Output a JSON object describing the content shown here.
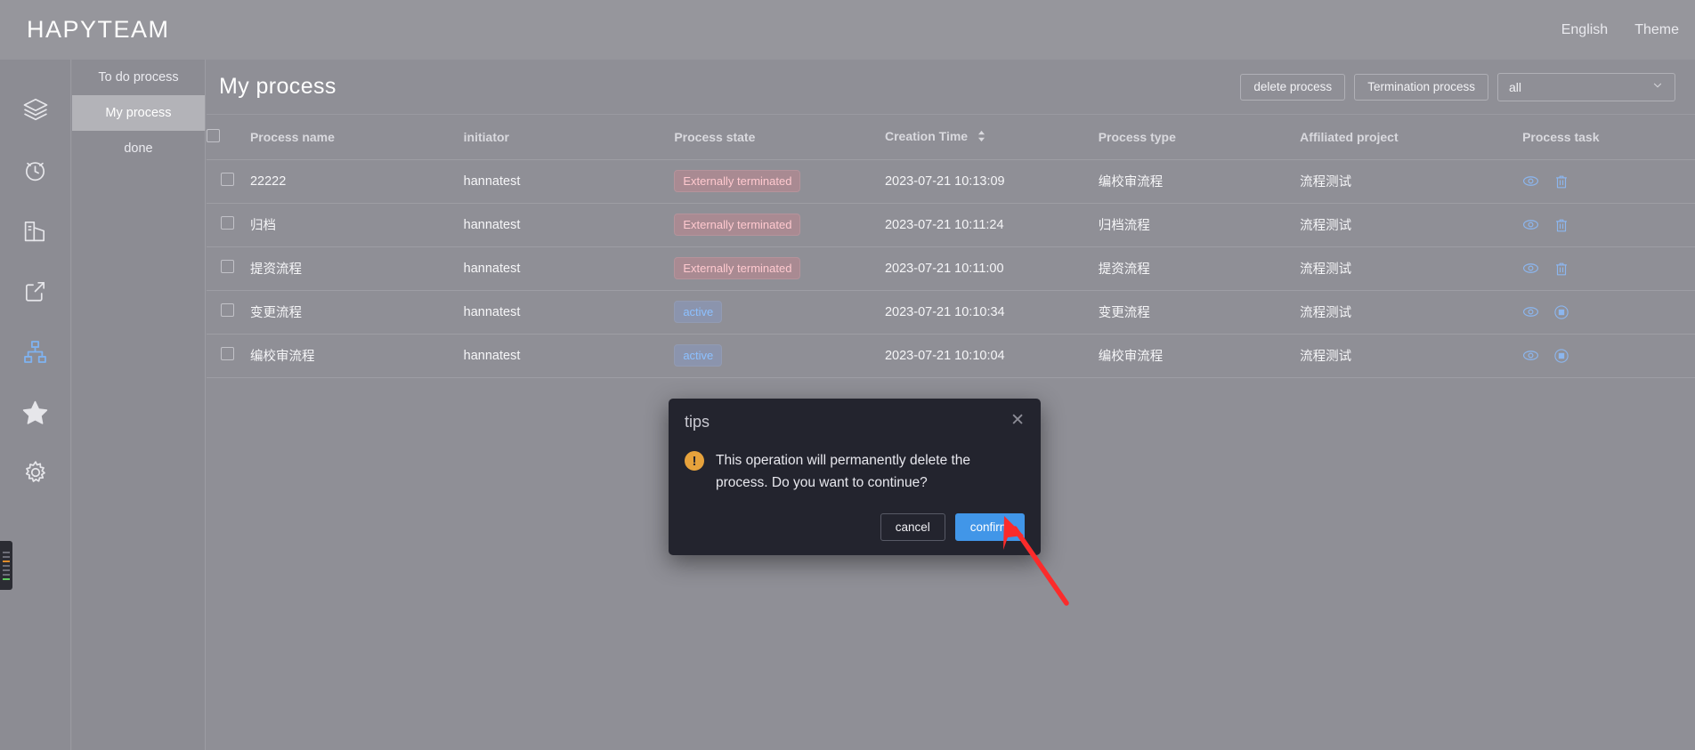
{
  "header": {
    "brand": "HAPYTEAM",
    "links": [
      {
        "label": "English",
        "name": "language-link"
      },
      {
        "label": "Theme",
        "name": "theme-link"
      }
    ]
  },
  "rail": {
    "items": [
      {
        "icon": "layers-icon",
        "active": false
      },
      {
        "icon": "alarm-clock-icon",
        "active": false
      },
      {
        "icon": "bar-chart-icon",
        "active": false
      },
      {
        "icon": "share-export-icon",
        "active": false
      },
      {
        "icon": "sitemap-icon",
        "active": true
      },
      {
        "icon": "star-icon",
        "active": false
      },
      {
        "icon": "gear-icon",
        "active": false
      }
    ],
    "active_color": "#7fb2f0",
    "inactive_color": "#e6e6ea"
  },
  "subnav": {
    "items": [
      {
        "label": "To do process",
        "active": false
      },
      {
        "label": "My process",
        "active": true
      },
      {
        "label": "done",
        "active": false
      }
    ]
  },
  "page": {
    "title": "My process",
    "buttons": {
      "delete_process": "delete process",
      "termination_process": "Termination process"
    },
    "filter": {
      "value": "all"
    }
  },
  "table": {
    "columns": [
      "Process name",
      "initiator",
      "Process state",
      "Creation Time",
      "Process type",
      "Affiliated project",
      "Process task"
    ],
    "sort_column": "Creation Time",
    "rows": [
      {
        "checked": false,
        "name": "22222",
        "initiator": "hannatest",
        "state": "Externally terminated",
        "state_kind": "terminated",
        "created": "2023-07-21 10:13:09",
        "type": "编校审流程",
        "project": "流程测试",
        "actions": [
          "view-icon",
          "delete-icon"
        ]
      },
      {
        "checked": false,
        "name": "归档",
        "initiator": "hannatest",
        "state": "Externally terminated",
        "state_kind": "terminated",
        "created": "2023-07-21 10:11:24",
        "type": "归档流程",
        "project": "流程测试",
        "actions": [
          "view-icon",
          "delete-icon"
        ]
      },
      {
        "checked": false,
        "name": "提资流程",
        "initiator": "hannatest",
        "state": "Externally terminated",
        "state_kind": "terminated",
        "created": "2023-07-21 10:11:00",
        "type": "提资流程",
        "project": "流程测试",
        "actions": [
          "view-icon",
          "delete-icon"
        ]
      },
      {
        "checked": false,
        "name": "变更流程",
        "initiator": "hannatest",
        "state": "active",
        "state_kind": "active",
        "created": "2023-07-21 10:10:34",
        "type": "变更流程",
        "project": "流程测试",
        "actions": [
          "view-icon",
          "stop-icon"
        ]
      },
      {
        "checked": false,
        "name": "编校审流程",
        "initiator": "hannatest",
        "state": "active",
        "state_kind": "active",
        "created": "2023-07-21 10:10:04",
        "type": "编校审流程",
        "project": "流程测试",
        "actions": [
          "view-icon",
          "stop-icon"
        ]
      }
    ]
  },
  "dialog": {
    "title": "tips",
    "message": "This operation will permanently delete the process. Do you want to continue?",
    "cancel": "cancel",
    "confirm": "confirm",
    "warn_glyph": "!",
    "close_glyph": "✕",
    "confirm_color": "#4196e8",
    "warn_color": "#e6a23c"
  },
  "colors": {
    "page_bg": "#8f8f96",
    "topbar_bg": "#96969c",
    "terminated_text": "#ffc9cf",
    "active_text": "#8cc0ff",
    "annotation_arrow": "#fb2b2b"
  }
}
